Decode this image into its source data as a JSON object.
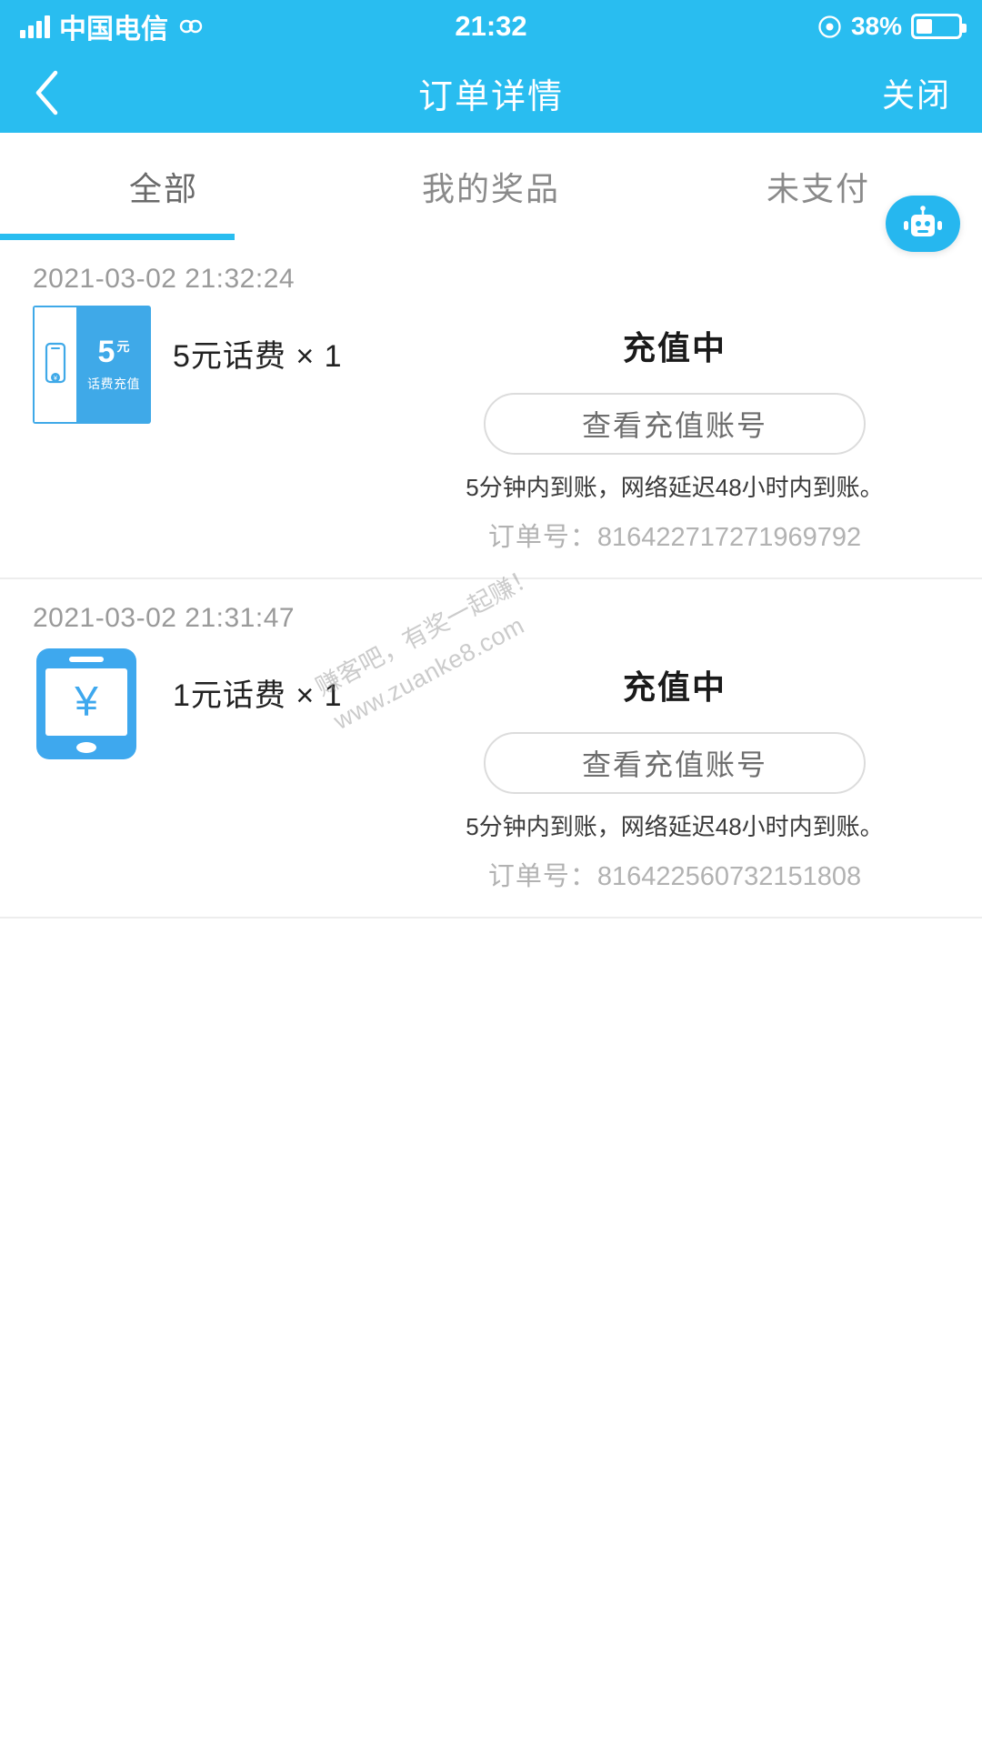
{
  "status_bar": {
    "carrier": "中国电信",
    "time": "21:32",
    "battery_percent": "38%",
    "signal_icon": "signal-bars-icon",
    "link_icon": "link-chain-icon",
    "alarm_icon": "alarm-clock-icon",
    "battery_icon": "battery-icon"
  },
  "nav": {
    "back_icon": "chevron-left-icon",
    "title": "订单详情",
    "close_label": "关闭"
  },
  "tabs": {
    "items": [
      {
        "label": "全部",
        "active": true
      },
      {
        "label": "我的奖品",
        "active": false
      },
      {
        "label": "未支付",
        "active": false
      }
    ]
  },
  "fab": {
    "icon": "robot-assistant-icon"
  },
  "orders": [
    {
      "time": "2021-03-02 21:32:24",
      "thumb_type": "coupon",
      "thumb": {
        "amount": "5",
        "unit": "元",
        "caption": "话费充值"
      },
      "product": "5元话费 × 1",
      "status": "充值中",
      "action_label": "查看充值账号",
      "note": "5分钟内到账，网络延迟48小时内到账。",
      "order_no_label": "订单号：",
      "order_no": "816422717271969792"
    },
    {
      "time": "2021-03-02 21:31:47",
      "thumb_type": "phone",
      "thumb": {
        "symbol": "¥"
      },
      "product": "1元话费 × 1",
      "status": "充值中",
      "action_label": "查看充值账号",
      "note": "5分钟内到账，网络延迟48小时内到账。",
      "order_no_label": "订单号：",
      "order_no": "816422560732151808"
    }
  ],
  "watermark": {
    "line1": "赚客吧，有奖一起赚！",
    "line2": "www.zuanke8.com"
  },
  "colors": {
    "brand": "#29bdf0",
    "coupon": "#3fa9e8",
    "text_primary": "#222222",
    "text_muted": "#9a9a9a"
  }
}
